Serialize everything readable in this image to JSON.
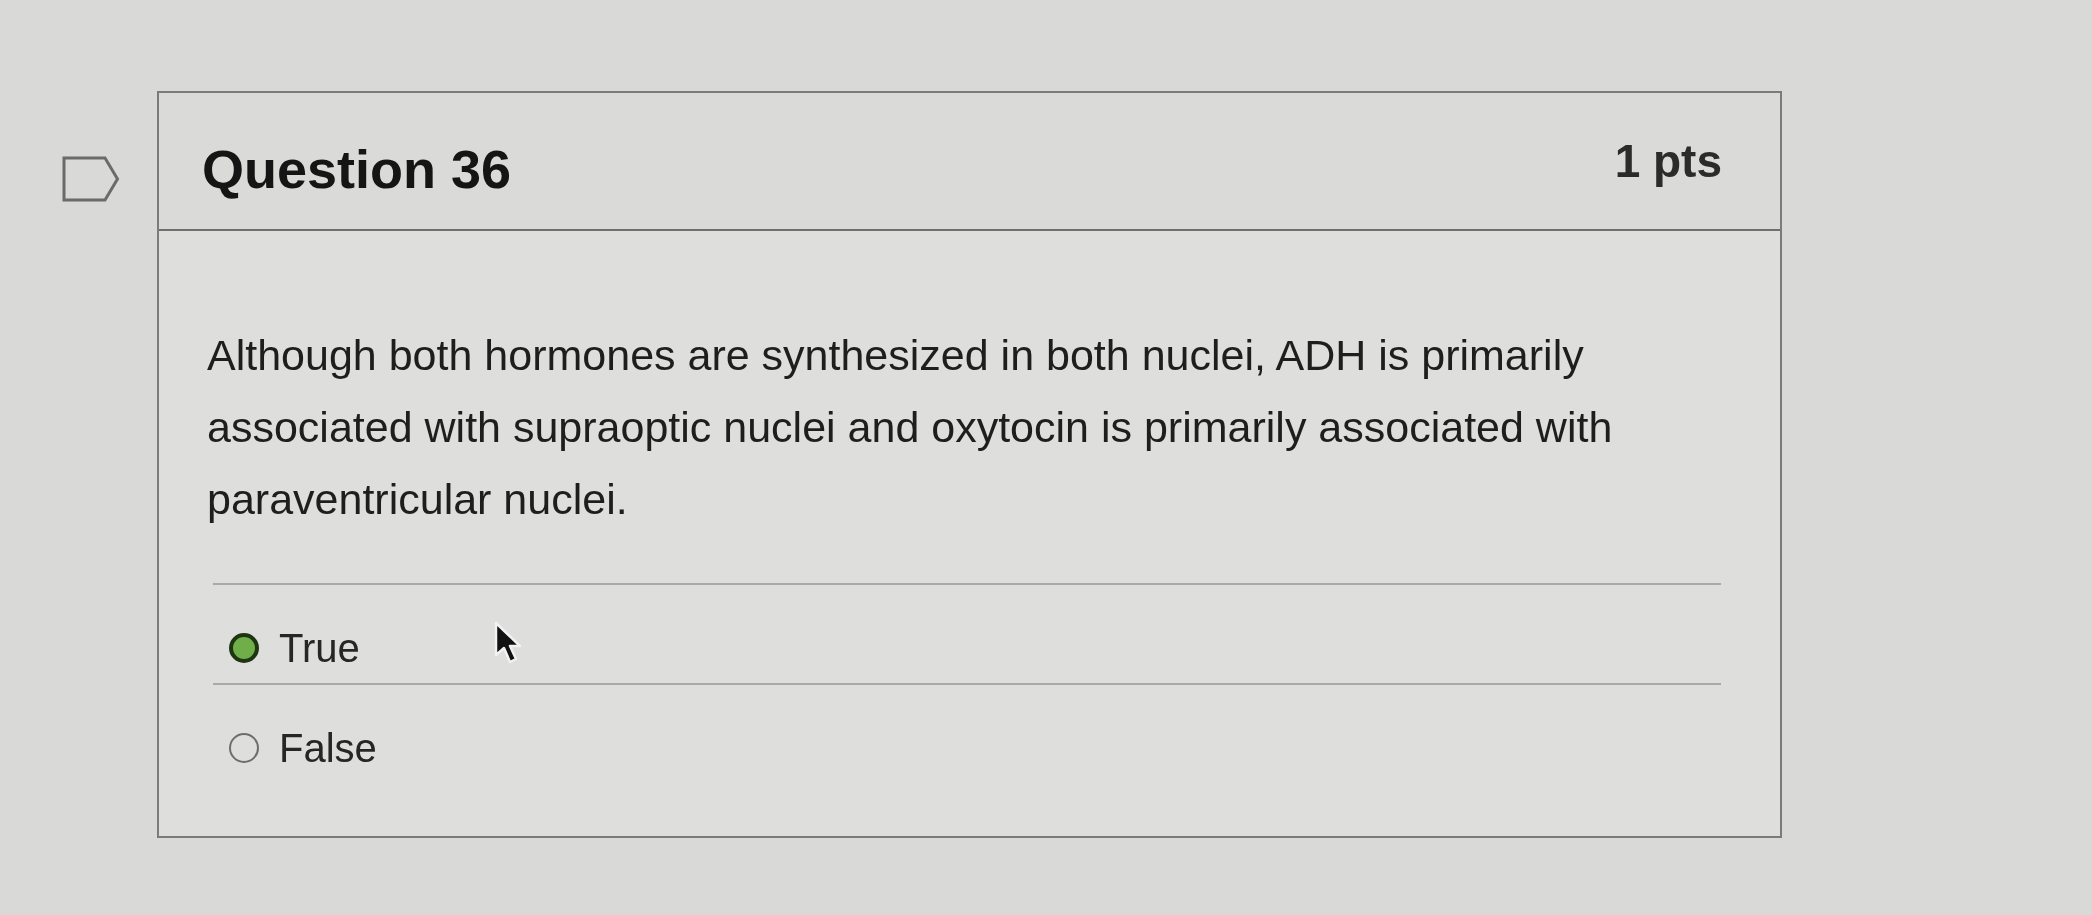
{
  "question": {
    "title": "Question 36",
    "points": "1 pts",
    "flagged": false,
    "text": "Although both hormones are synthesized in both nuclei, ADH is primarily associated with supraoptic nuclei and oxytocin is primarily associated with paraventricular nuclei.",
    "answers": [
      {
        "label": "True",
        "selected": true
      },
      {
        "label": "False",
        "selected": false
      }
    ]
  }
}
